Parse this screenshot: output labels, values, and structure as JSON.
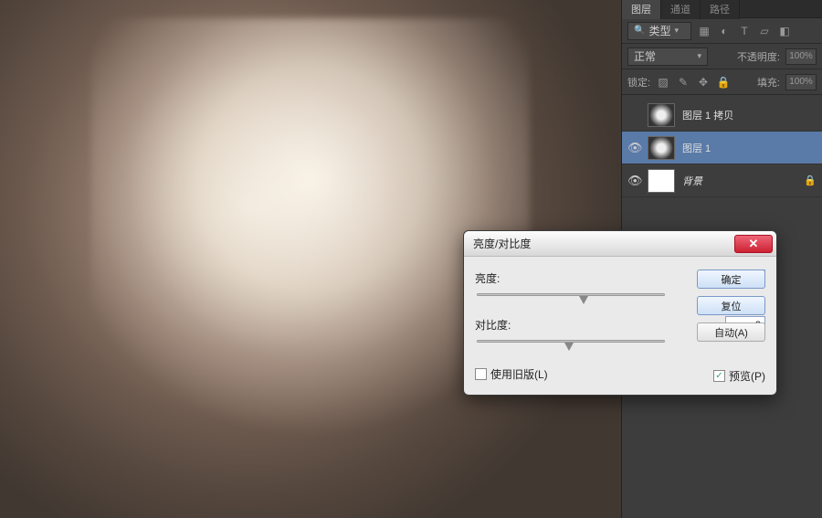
{
  "panel": {
    "tabs": [
      "图层",
      "通道",
      "路径"
    ],
    "type_label": "类型",
    "blend_mode": "正常",
    "opacity_label": "不透明度:",
    "opacity_value": "100%",
    "lock_label": "锁定:",
    "fill_label": "填充:",
    "fill_value": "100%",
    "layers": [
      {
        "name": "图层 1 拷贝",
        "visible": false,
        "thumb": "dark"
      },
      {
        "name": "图层 1",
        "visible": true,
        "thumb": "dark",
        "selected": true
      },
      {
        "name": "背景",
        "visible": true,
        "thumb": "white",
        "italic": true,
        "locked": true
      }
    ]
  },
  "dialog": {
    "title": "亮度/对比度",
    "brightness_label": "亮度:",
    "brightness_value": "21",
    "contrast_label": "对比度:",
    "contrast_value": "-2",
    "ok": "确定",
    "reset": "复位",
    "auto": "自动(A)",
    "legacy": "使用旧版(L)",
    "preview": "预览(P)"
  }
}
